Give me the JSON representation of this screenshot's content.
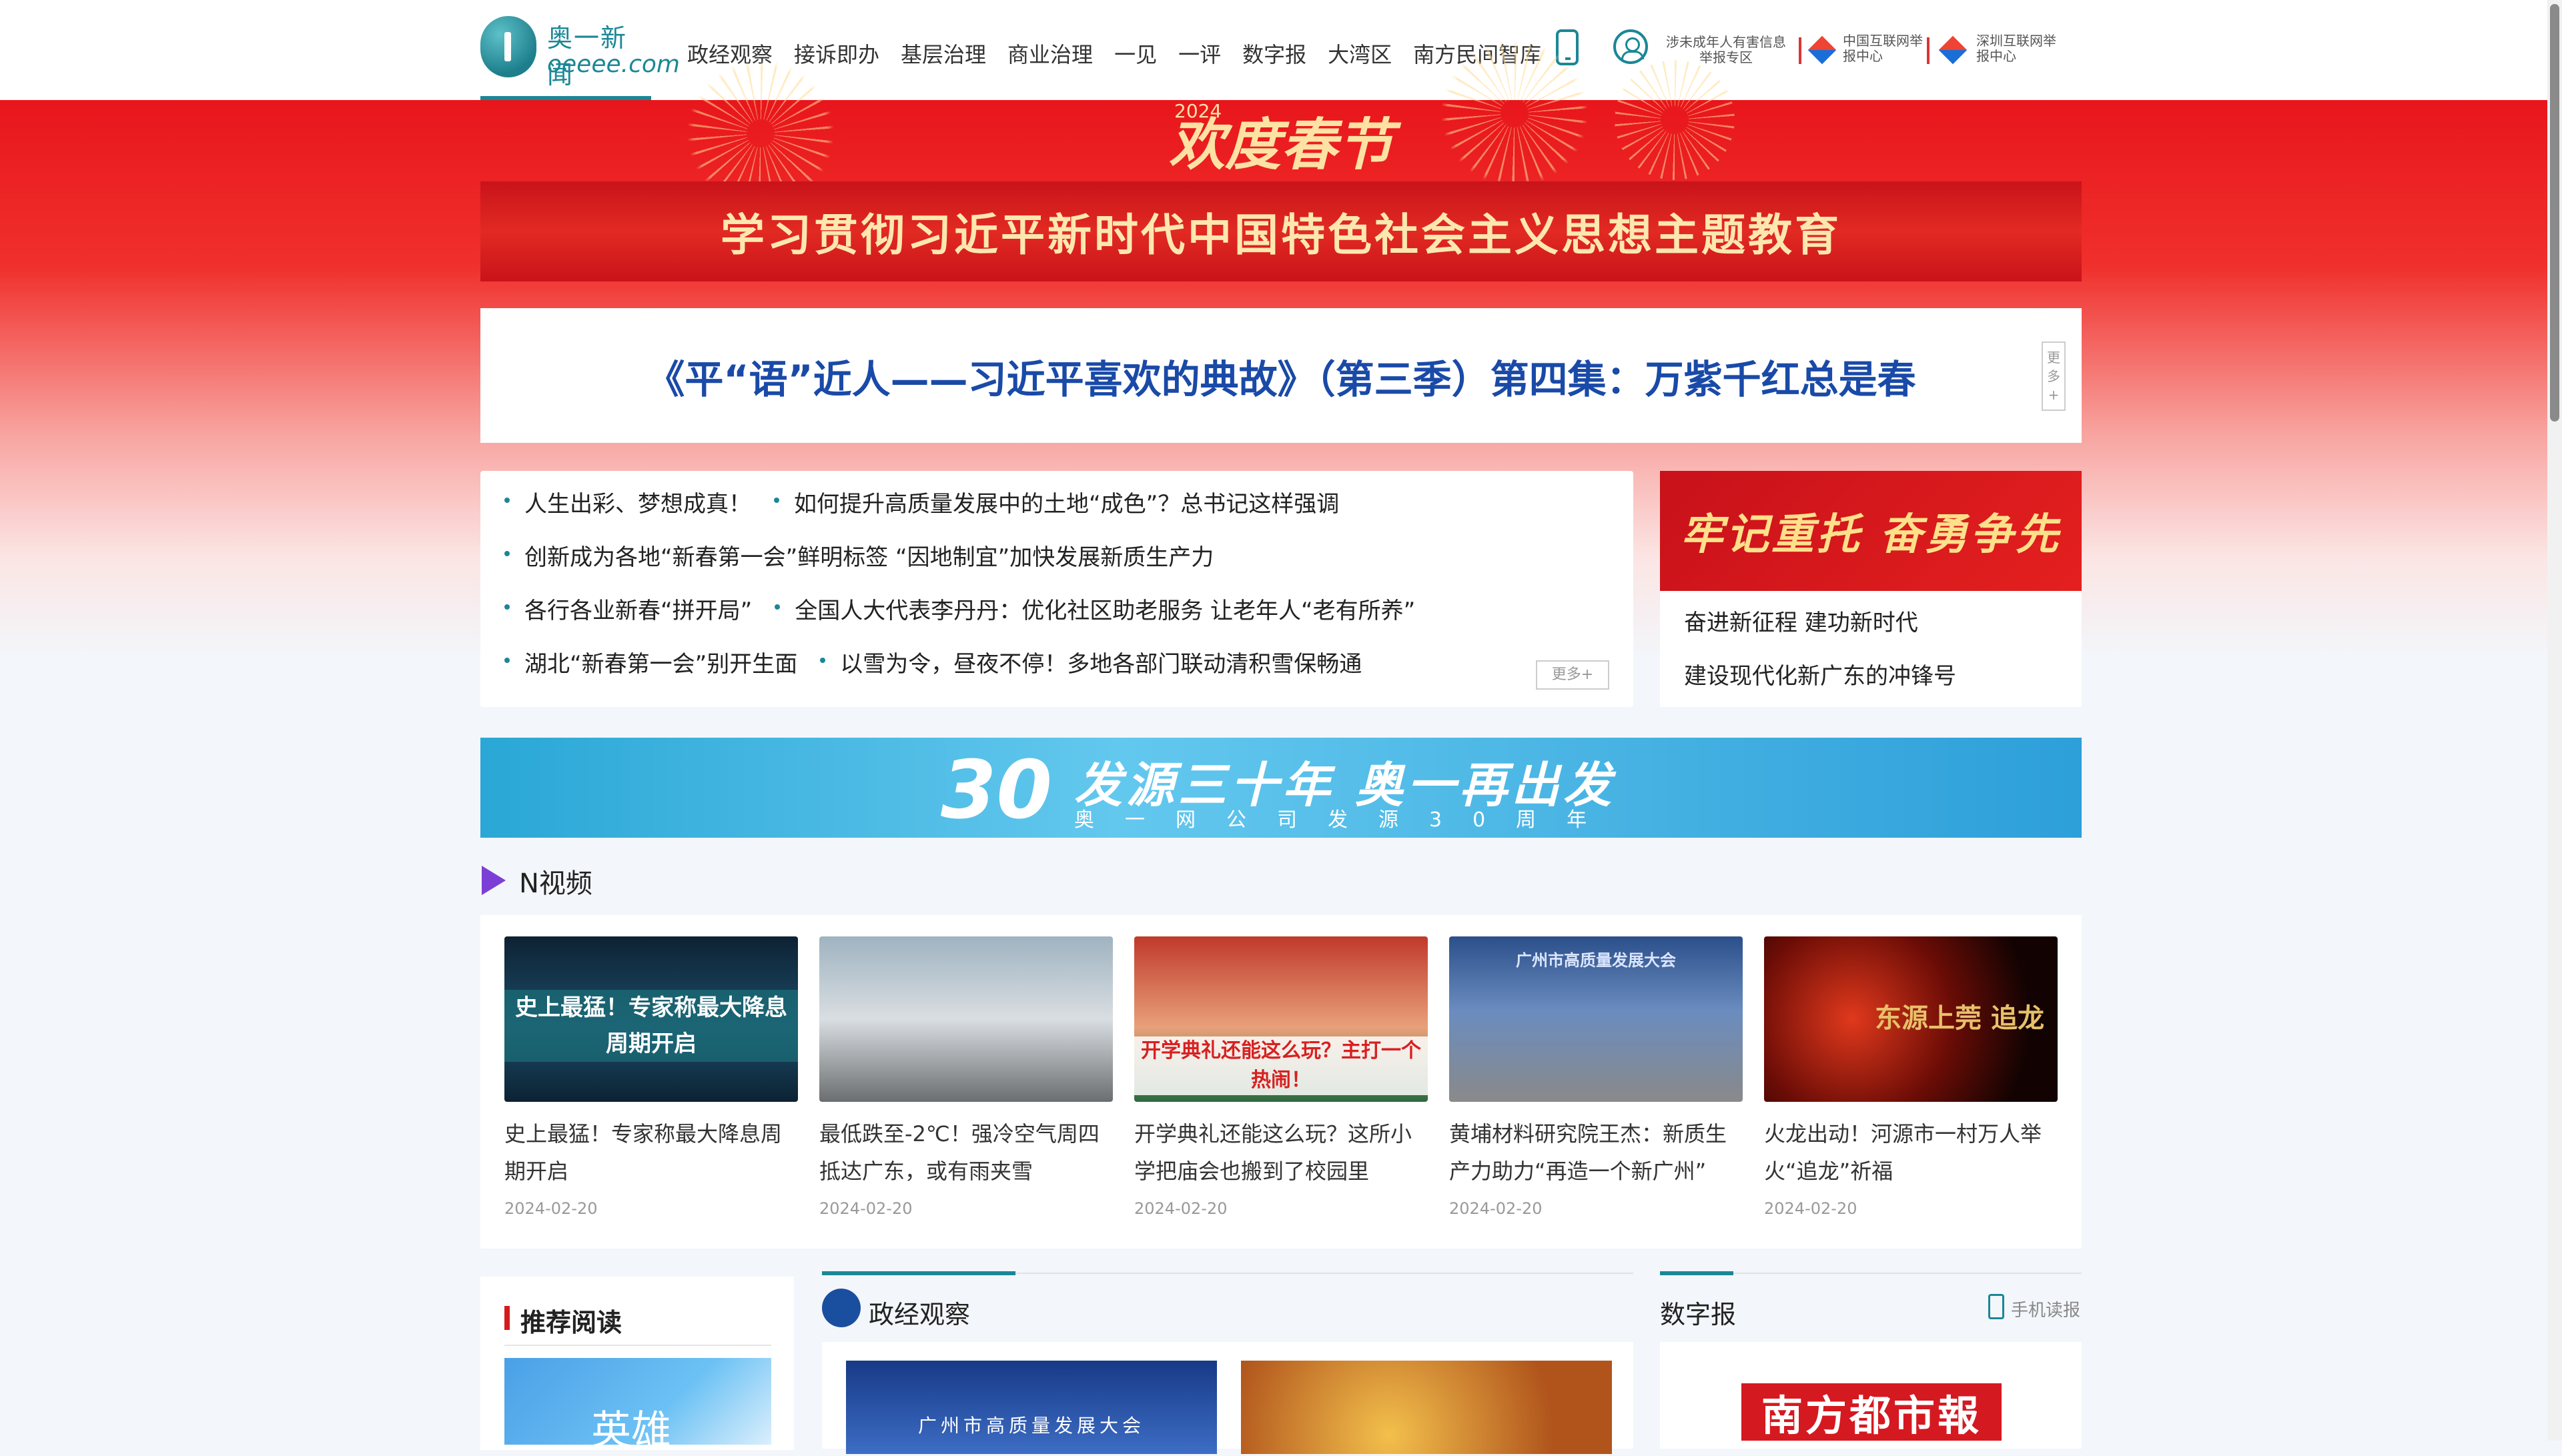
{
  "header": {
    "logo_cn": "奥一新闻",
    "logo_en": "oeeee.com",
    "nav": [
      "政经观察",
      "接诉即办",
      "基层治理",
      "商业治理",
      "一见",
      "一评",
      "数字报",
      "大湾区",
      "南方民间智库"
    ],
    "report_minor": "涉未成年人有害信息举报专区",
    "report_cac": "中国互联网举报中心",
    "report_sz": "深圳互联网举报中心"
  },
  "hero": {
    "spring_year": "2024",
    "spring_title": "欢度春节",
    "theme": "学习贯彻习近平新时代中国特色社会主义思想主题教育"
  },
  "headline": {
    "text": "《平“语”近人——习近平喜欢的典故》（第三季）第四集：万紫千红总是春",
    "more": "更多+"
  },
  "news": {
    "rows": [
      [
        "人生出彩、梦想成真！",
        "如何提升高质量发展中的土地“成色”？总书记这样强调"
      ],
      [
        "创新成为各地“新春第一会”鲜明标签 “因地制宜”加快发展新质生产力"
      ],
      [
        "各行各业新春“拼开局”",
        "全国人大代表李丹丹：优化社区助老服务 让老年人“老有所养”"
      ],
      [
        "湖北“新春第一会”别开生面",
        "以雪为令，昼夜不停！多地各部门联动清积雪保畅通"
      ]
    ],
    "more": "更多+"
  },
  "right_card": {
    "banner": "牢记重托 奋勇争先",
    "links": [
      "奋进新征程 建功新时代",
      "建设现代化新广东的冲锋号"
    ]
  },
  "anniversary": {
    "number": "30",
    "title": "发源三十年 奥一再出发",
    "sub": "奥一网公司发源30周年"
  },
  "nvideo": {
    "title": "N视频",
    "items": [
      {
        "thumb_caption": "史上最猛！专家称最大降息周期开启",
        "title": "史上最猛！专家称最大降息周期开启",
        "date": "2024-02-20"
      },
      {
        "thumb_caption": "",
        "title": "最低跌至-2℃！强冷空气周四抵达广东，或有雨夹雪",
        "date": "2024-02-20"
      },
      {
        "thumb_caption": "开学典礼还能这么玩？主打一个热闹！",
        "title": "开学典礼还能这么玩？这所小学把庙会也搬到了校园里",
        "date": "2024-02-20"
      },
      {
        "thumb_caption": "广州市高质量发展大会",
        "title": "黄埔材料研究院王杰：新质生产力助力“再造一个新广州”",
        "date": "2024-02-20"
      },
      {
        "thumb_caption": "东源上莞 追龙",
        "title": "火龙出动！河源市一村万人举火“追龙”祈福",
        "date": "2024-02-20"
      }
    ]
  },
  "sections": {
    "recommend": "推荐阅读",
    "rec_img_caption": "英雄",
    "zhengjing": "政经观察",
    "zj_img1_caption": "广州市高质量发展大会",
    "digital_paper": "数字报",
    "mobile_read": "手机读报",
    "paper_name": "南方都市報"
  },
  "colors": {
    "accent": "#1b8796",
    "hero_red": "#e8161c",
    "headline_blue": "#1a4aa8"
  }
}
